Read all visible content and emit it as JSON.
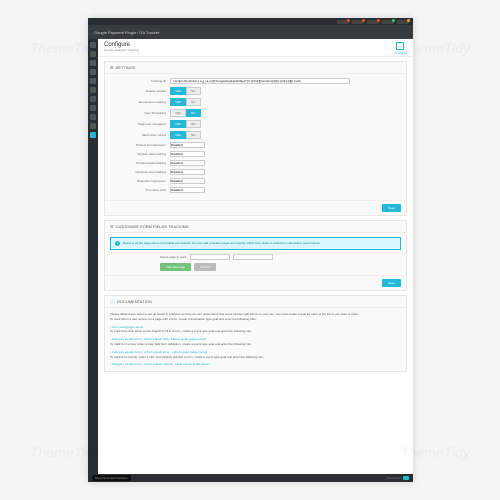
{
  "watermarks": [
    "ThemeTidy",
    "ThemeTidy",
    "ThemeTidy",
    "ThemeTidy"
  ],
  "title": "Google Payment Plugin / GA Tracker",
  "header": {
    "title": "Configure",
    "sub": "Google Analytics Tracking",
    "configBtn": "Configure"
  },
  "settings": {
    "heading": "SETTINGS",
    "saveBtn": "Save",
    "rows": [
      {
        "label": "Tracking ID",
        "type": "text",
        "value": "<script>(function(i,s,o,g,r,a,m){i['GoogleAnalyticsObject']=r;i[r]=i[r]||function(){(i[r].q=i[r].q||[]).push..."
      },
      {
        "label": "Enable module",
        "type": "toggle",
        "on": "YES",
        "off": "NO",
        "value": true
      },
      {
        "label": "Ecommerce tracking",
        "type": "toggle",
        "on": "YES",
        "off": "NO",
        "value": true
      },
      {
        "label": "User ID tracking",
        "type": "toggle",
        "on": "YES",
        "off": "NO",
        "value": false
      },
      {
        "label": "Track user navigation",
        "type": "toggle",
        "on": "YES",
        "off": "NO",
        "value": true
      },
      {
        "label": "Send order refund",
        "type": "toggle",
        "on": "YES",
        "off": "NO",
        "value": true
      },
      {
        "label": "Product list impression",
        "type": "select",
        "value": "Disabled"
      },
      {
        "label": "Product click tracking",
        "type": "select",
        "value": "Disabled"
      },
      {
        "label": "Product detail tracking",
        "type": "select",
        "value": "Disabled"
      },
      {
        "label": "Checkout step tracking",
        "type": "select",
        "value": "Disabled"
      },
      {
        "label": "Promotion impression",
        "type": "select",
        "value": "Disabled"
      },
      {
        "label": "Promotion click",
        "type": "select",
        "value": "Disabled"
      }
    ]
  },
  "forms": {
    "heading": "CUSTOMIZE FORM FIELDS TRACKING",
    "alert": "Below is all the page where form fields are tracked.\nYou can add or delete pages and specify which form fields to track form submission performance.",
    "selectorLabel": "Select page to track",
    "selector": "---",
    "addBtn": "Add new page",
    "cancelBtn": "Cancel",
    "saveBtn": "Save"
  },
  "doc": {
    "heading": "DOCUMENTATION",
    "intro": "Please follow these steps to set up Goals in Analytics so that you can understand how users interact with forms on your site. You must create a goal for each of the forms you want to track.",
    "bullets": [
      "To track when a user arrives on a page with a form, create a destination type goal and enter the following URL:",
      "› /form-view/[page-name]",
      "To track form visit: when a user begins to fill in a form, create a event type goal and enter the following info:",
      "› Category equals Form · Action equals Visit · Label equals [page-name]",
      "To track form errors: when a user fails form validation, create a event type goal and enter the following info:",
      "› Category equals Form · Action equals Error · Label equals [page-name]",
      "To track form submit: when a user successfully submits a form, create a event type goal and enter the following info:",
      "› Category equals Form · Action equals Submit · Label equals [page-name]"
    ]
  },
  "footer": {
    "left": "Recommended Modules",
    "right": "Connect to"
  }
}
